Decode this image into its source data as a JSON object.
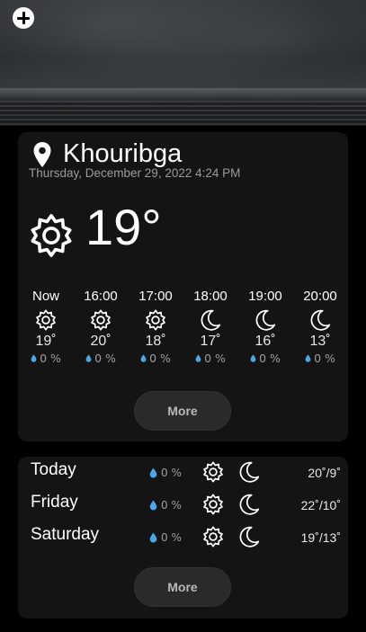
{
  "header": {
    "add_label": "+"
  },
  "location": {
    "city": "Khouribga",
    "datetime": "Thursday, December 29, 2022 4:24 PM"
  },
  "current": {
    "temp": "19°",
    "icon": "sun-icon"
  },
  "hourly": [
    {
      "time": "Now",
      "icon": "sun-icon",
      "temp": "19˚",
      "precip": "0 %"
    },
    {
      "time": "16:00",
      "icon": "sun-icon",
      "temp": "20˚",
      "precip": "0 %"
    },
    {
      "time": "17:00",
      "icon": "sun-icon",
      "temp": "18˚",
      "precip": "0 %"
    },
    {
      "time": "18:00",
      "icon": "moon-icon",
      "temp": "17˚",
      "precip": "0 %"
    },
    {
      "time": "19:00",
      "icon": "moon-icon",
      "temp": "16˚",
      "precip": "0 %"
    },
    {
      "time": "20:00",
      "icon": "moon-icon",
      "temp": "13˚",
      "precip": "0 %"
    }
  ],
  "daily": [
    {
      "day": "Today",
      "precip": "0 %",
      "day_icon": "sun-icon",
      "night_icon": "moon-icon",
      "minmax": "20˚/9˚"
    },
    {
      "day": "Friday",
      "precip": "0 %",
      "day_icon": "sun-icon",
      "night_icon": "moon-icon",
      "minmax": "22˚/10˚"
    },
    {
      "day": "Saturday",
      "precip": "0 %",
      "day_icon": "sun-icon",
      "night_icon": "moon-icon",
      "minmax": "19˚/13˚"
    }
  ],
  "buttons": {
    "more_hourly": "More",
    "more_daily": "More"
  },
  "colors": {
    "card_bg": "#141414",
    "drop": "#4aa8e8",
    "muted": "#9b9b9b"
  }
}
